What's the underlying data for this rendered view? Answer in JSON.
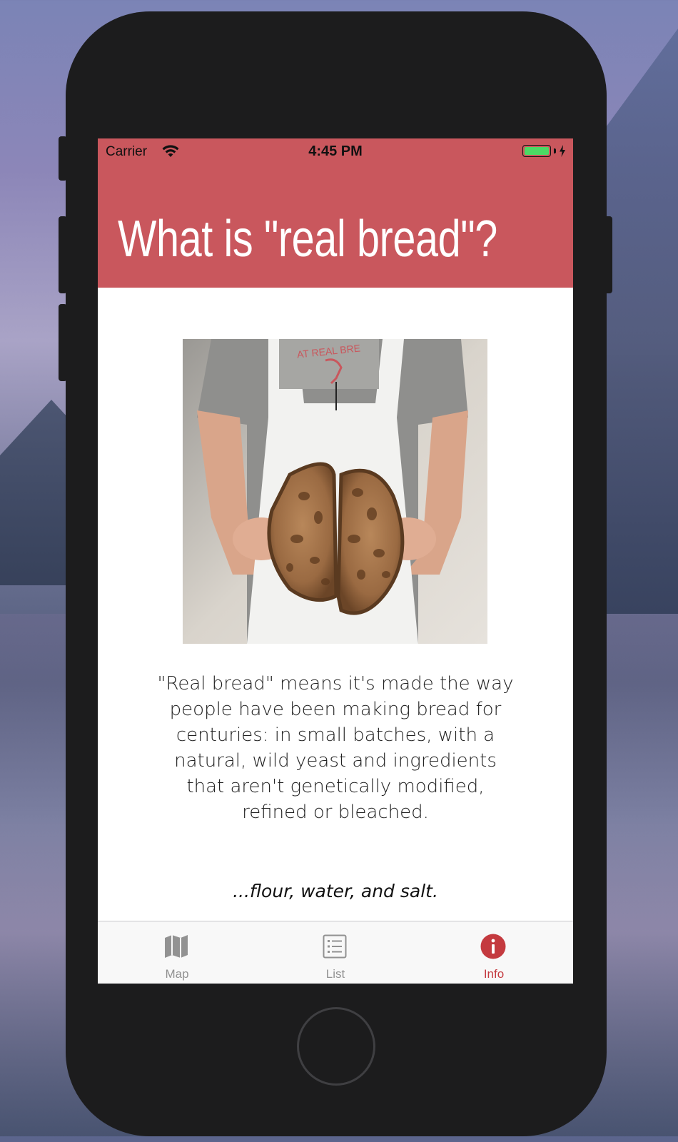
{
  "status_bar": {
    "carrier": "Carrier",
    "time": "4:45 PM",
    "battery_color": "#4cd964"
  },
  "header": {
    "title": "What is \"real bread\"?",
    "background": "#c9575d"
  },
  "content": {
    "image": "baker-holding-bread-image",
    "paragraph": "\"Real bread\" means it's made the way people have been making bread for centuries: in small batches, with a natural, wild yeast and ingredients that aren't genetically modified, refined or bleached.",
    "tagline": "...flour, water, and salt."
  },
  "tabbar": {
    "tabs": [
      {
        "label": "Map",
        "icon": "map-icon",
        "active": false
      },
      {
        "label": "List",
        "icon": "list-icon",
        "active": false
      },
      {
        "label": "Info",
        "icon": "info-icon",
        "active": true
      }
    ],
    "active_color": "#c43a3f",
    "inactive_color": "#929292"
  }
}
